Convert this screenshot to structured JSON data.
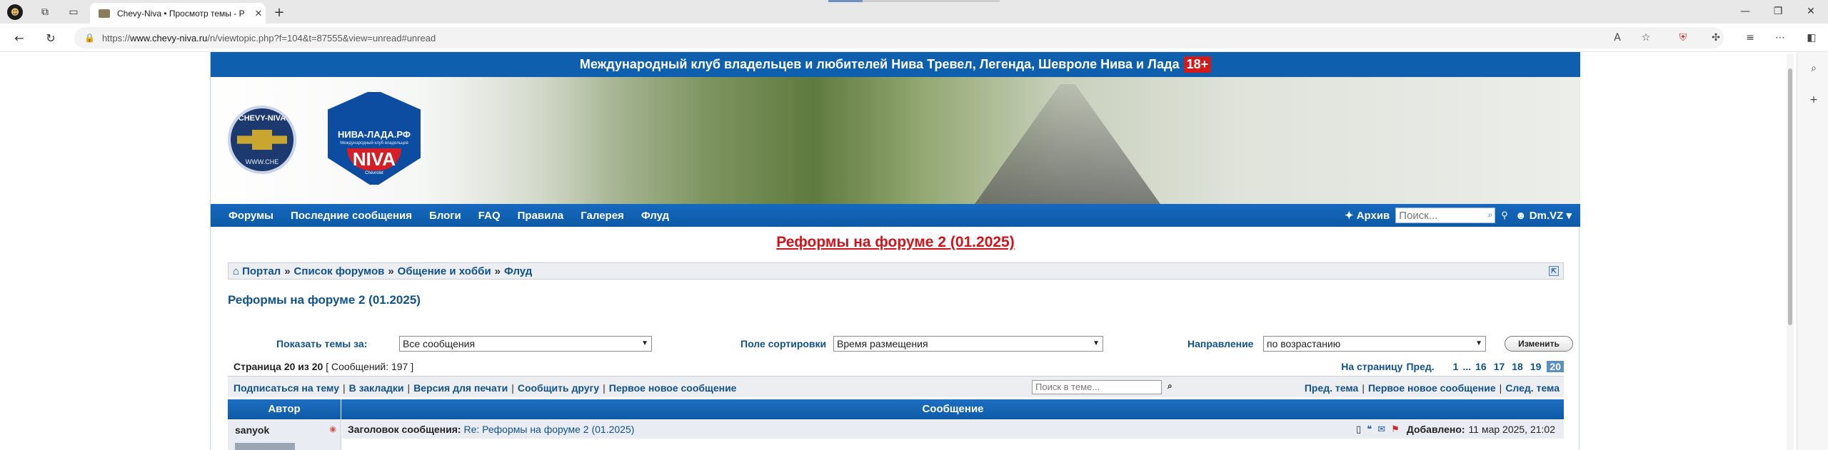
{
  "browser": {
    "tab_title": "Chevy-Niva • Просмотр темы - Р",
    "url_prefix": "https://",
    "url_host": "www.chevy-niva.ru",
    "url_path": "/n/viewtopic.php?f=104&t=87555&view=unread#unread"
  },
  "site": {
    "banner_text": "Международный клуб владельцев и любителей Нива Тревел, Легенда, Шевроле Нива и Лада",
    "age_badge": "18+",
    "logo1_text_top": "CHEVY-NIVA",
    "logo1_text_bottom": "WWW.CHE",
    "logo2_title": "НИВА-ЛАДА.РФ",
    "logo2_subtitle": "Международный клуб владельцев",
    "logo2_brand": "NIVA",
    "logo2_small": "Chevrolet"
  },
  "nav": {
    "items": [
      "Форумы",
      "Последние сообщения",
      "Блоги",
      "FAQ",
      "Правила",
      "Галерея",
      "Флуд"
    ],
    "archive": "Архив",
    "search_placeholder": "Поиск...",
    "user": "Dm.VZ"
  },
  "announcement": "Реформы на форуме 2 (01.2025)",
  "breadcrumb": {
    "items": [
      "Портал",
      "Список форумов",
      "Общение и хобби",
      "Флуд"
    ],
    "separator": "»"
  },
  "topic_title": "Реформы на форуме 2 (01.2025)",
  "sort": {
    "show_label": "Показать темы за:",
    "show_value": "Все сообщения",
    "field_label": "Поле сортировки",
    "field_value": "Время размещения",
    "direction_label": "Направление",
    "direction_value": "по возрастанию",
    "button": "Изменить"
  },
  "pagination": {
    "page_label": "Страница 20 из 20",
    "count_text": "[ Сообщений: 197 ]",
    "to_page_label": "На страницу",
    "prev": "Пред.",
    "pages": [
      "1",
      "...",
      "16",
      "17",
      "18",
      "19"
    ],
    "current": "20"
  },
  "tools": {
    "links": [
      "Подписаться на тему",
      "В закладки",
      "Версия для печати",
      "Сообщить другу",
      "Первое новое сообщение"
    ],
    "search_placeholder": "Поиск в теме...",
    "right_links": [
      "Пред. тема",
      "Первое новое сообщение",
      "След. тема"
    ]
  },
  "table": {
    "col_author": "Автор",
    "col_message": "Сообщение"
  },
  "post": {
    "author": "sanyok",
    "subject_label": "Заголовок сообщения:",
    "subject": "Re: Реформы на форуме 2 (01.2025)",
    "added_label": "Добавлено:",
    "date": "11 мар 2025, 21:02"
  },
  "colors": {
    "brand_blue": "#0e5fae",
    "link_blue": "#105289",
    "announce_red": "#d0141b"
  }
}
